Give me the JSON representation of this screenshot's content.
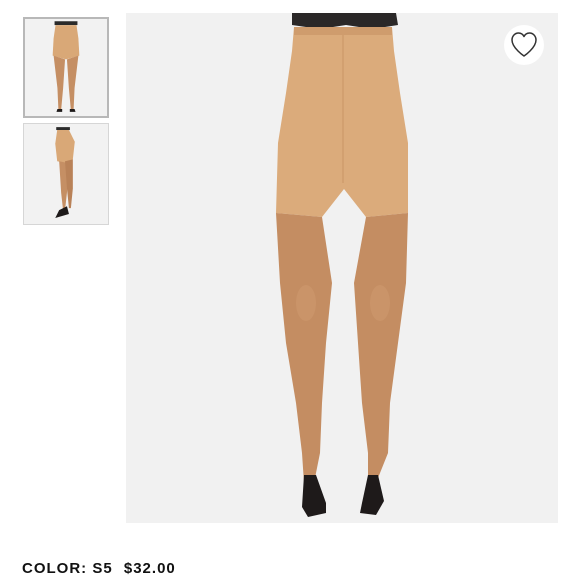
{
  "product": {
    "color_label": "COLOR:",
    "color_value": "S5",
    "price": "$32.00"
  },
  "thumbnails": [
    {
      "view": "front",
      "selected": true
    },
    {
      "view": "side",
      "selected": false
    }
  ],
  "icons": {
    "wishlist": "heart-outline-icon"
  },
  "colors": {
    "skin_tone": "#d9a878",
    "hosiery": "#c58f64",
    "shoe": "#1e1a1a",
    "background": "#f1f1f1"
  }
}
